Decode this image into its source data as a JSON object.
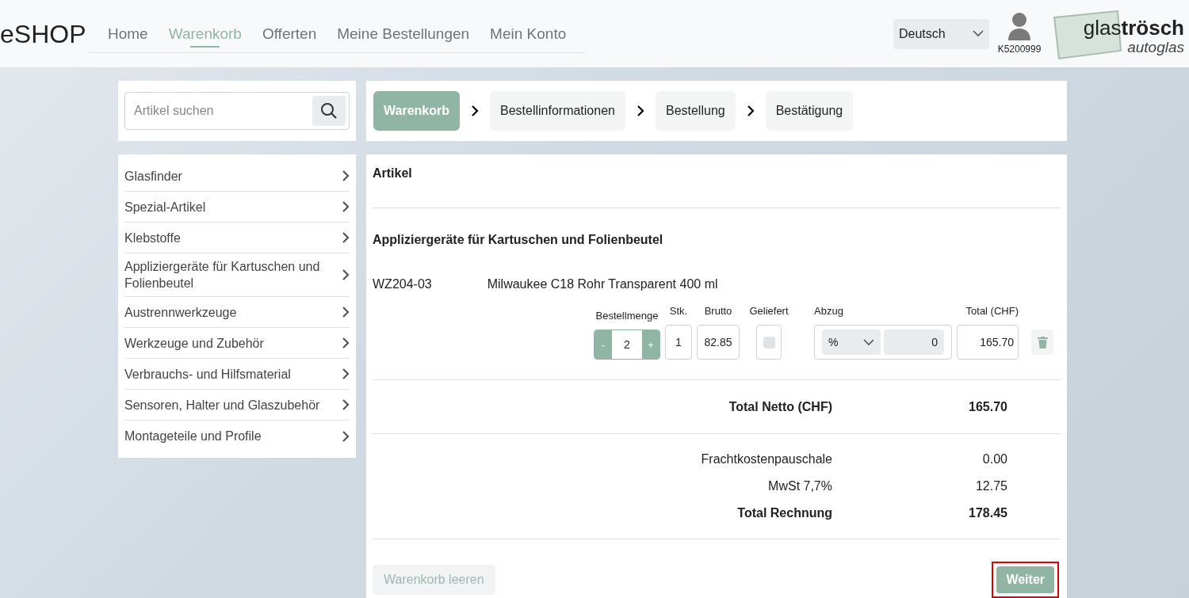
{
  "header": {
    "brand": "eSHOP",
    "nav": [
      {
        "label": "Home",
        "selected": false
      },
      {
        "label": "Warenkorb",
        "selected": true
      },
      {
        "label": "Offerten",
        "selected": false
      },
      {
        "label": "Meine Bestellungen",
        "selected": false
      },
      {
        "label": "Mein Konto",
        "selected": false
      }
    ],
    "language": "Deutsch",
    "user": "K5200999",
    "logo": {
      "name": "glas**trösch**",
      "sub": "autoglas"
    }
  },
  "search": {
    "placeholder": "Artikel suchen"
  },
  "categories": [
    "Glasfinder",
    "Spezial-Artikel",
    "Klebstoffe",
    "Appliziergeräte für Kartuschen und Folienbeutel",
    "Austrennwerkzeuge",
    "Werkzeuge und Zubehör",
    "Verbrauchs- und Hilfsmaterial",
    "Sensoren, Halter und Glaszubehör",
    "Montageteile und Profile"
  ],
  "steps": [
    {
      "label": "Warenkorb",
      "selected": true
    },
    {
      "label": "Bestellinformationen",
      "selected": false
    },
    {
      "label": "Bestellung",
      "selected": false
    },
    {
      "label": "Bestätigung",
      "selected": false
    }
  ],
  "cart": {
    "title": "Artikel",
    "group": "Appliziergeräte für Kartuschen und Folienbeutel",
    "item": {
      "code": "WZ204-03",
      "name": "Milwaukee C18 Rohr Transparent 400 ml",
      "headers": [
        "Bestellmenge",
        "Stk.",
        "Brutto",
        "Geliefert",
        "Abzug",
        "Total (CHF)"
      ],
      "minus": "-",
      "quantity": "2",
      "plus": "+",
      "pieces": "1",
      "gross": "82.85",
      "delivered": false,
      "discount_unit": "%",
      "discount": "0",
      "total": "165.70"
    },
    "net": {
      "label": "Total Netto (CHF)",
      "value": "165.70"
    },
    "summary": [
      {
        "label": "Frachtkostenpauschale",
        "value": "0.00",
        "bold": false
      },
      {
        "label": "MwSt 7,7%",
        "value": "12.75",
        "bold": false
      },
      {
        "label": "Total Rechnung",
        "value": "178.45",
        "bold": true
      }
    ]
  },
  "buttons": {
    "clear": {
      "label": "Warenkorb leeren",
      "disabled": true
    },
    "next": {
      "label": "Weiter",
      "highlighted": true
    }
  }
}
